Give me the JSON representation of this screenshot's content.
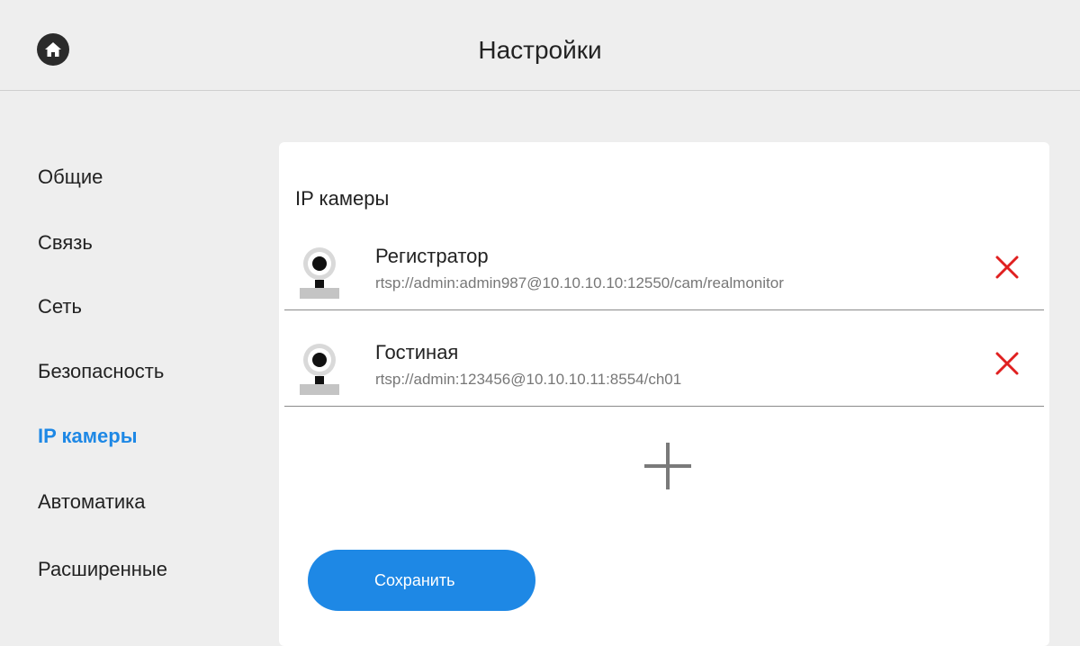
{
  "header": {
    "title": "Настройки",
    "home_icon": "home-icon"
  },
  "sidebar": {
    "items": [
      {
        "label": "Общие",
        "active": false
      },
      {
        "label": "Связь",
        "active": false
      },
      {
        "label": "Сеть",
        "active": false
      },
      {
        "label": "Безопасность",
        "active": false
      },
      {
        "label": "IP камеры",
        "active": true
      },
      {
        "label": "Автоматика",
        "active": false
      },
      {
        "label": "Расширенные",
        "active": false
      }
    ]
  },
  "main": {
    "section_title": "IP камеры",
    "cameras": [
      {
        "name": "Регистратор",
        "url": "rtsp://admin:admin987@10.10.10.10:12550/cam/realmonitor"
      },
      {
        "name": "Гостиная",
        "url": "rtsp://admin:123456@10.10.10.11:8554/ch01"
      }
    ],
    "save_label": "Сохранить"
  },
  "colors": {
    "accent": "#1e88e5",
    "delete": "#e02020",
    "background": "#eeeeee",
    "card": "#ffffff"
  }
}
